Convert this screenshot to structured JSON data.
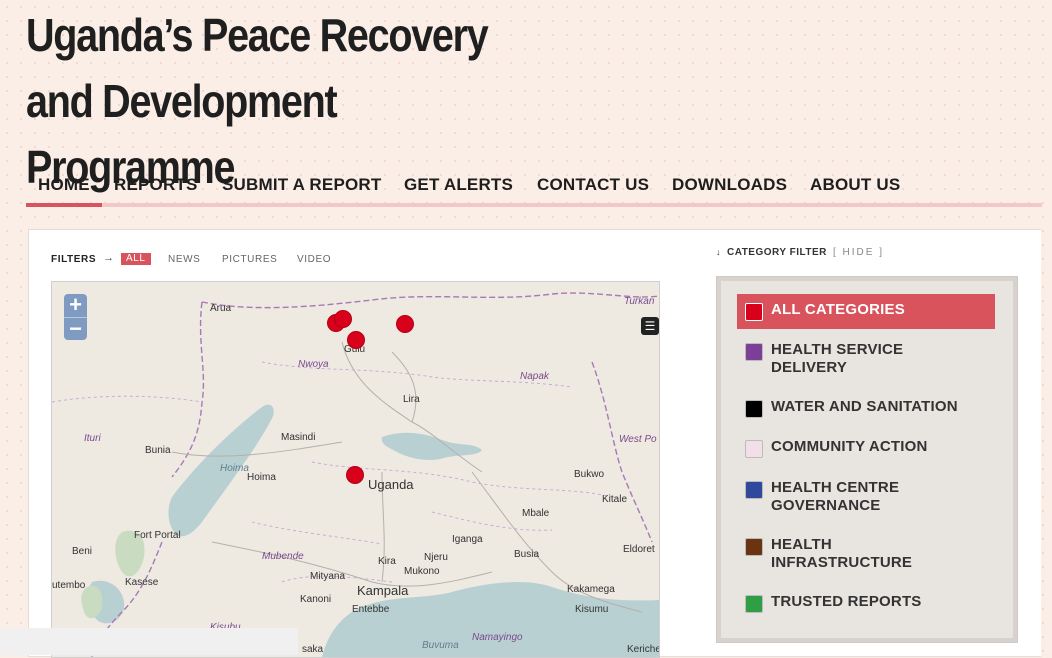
{
  "site": {
    "title": "Uganda’s Peace Recovery and Development Programme"
  },
  "nav": {
    "items": [
      {
        "label": "HOME",
        "active": true
      },
      {
        "label": "REPORTS"
      },
      {
        "label": "SUBMIT A REPORT"
      },
      {
        "label": "GET ALERTS"
      },
      {
        "label": "CONTACT US"
      },
      {
        "label": "DOWNLOADS"
      },
      {
        "label": "ABOUT US"
      }
    ]
  },
  "filters": {
    "label": "FILTERS",
    "arrow": "→",
    "options": [
      "ALL",
      "NEWS",
      "PICTURES",
      "VIDEO"
    ],
    "active": "ALL"
  },
  "map": {
    "zoom_in": "+",
    "zoom_out": "−",
    "layers_icon": "layers-icon",
    "places": {
      "arua": "Arua",
      "gulu": "Gulu",
      "nwoya": "Nwoya",
      "lira": "Lira",
      "napak": "Napak",
      "turkana": "Turkan",
      "ituri": "Ituri",
      "bunia": "Bunia",
      "masindi": "Masindi",
      "hoima_region": "Hoima",
      "hoima": "Hoima",
      "uganda": "Uganda",
      "west_pokot": "West Po",
      "bukwo": "Bukwo",
      "kitale": "Kitale",
      "mbale": "Mbale",
      "fort_portal": "Fort Portal",
      "beni": "Beni",
      "igang": "Iganga",
      "busia": "Busia",
      "eldoret": "Eldoret",
      "mubende": "Mubende",
      "kira": "Kira",
      "njeru": "Njeru",
      "mukono": "Mukono",
      "kasese": "Kasese",
      "mityana": "Mityana",
      "kakamega": "Kakamega",
      "kanoni": "Kanoni",
      "kampala": "Kampala",
      "kisumu": "Kisumu",
      "entebbe": "Entebbe",
      "lutembo": "utembo",
      "namayingo": "Namayingo",
      "kisubu": "Kisubu",
      "buvuma": "Buvuma",
      "masaka": "saka",
      "kericho": "Keriche"
    }
  },
  "category_filter": {
    "label": "CATEGORY FILTER",
    "hide_label": "[ HIDE ]",
    "categories": [
      {
        "label": "ALL CATEGORIES",
        "color": "#d9001b",
        "active": true
      },
      {
        "label": "HEALTH SERVICE DELIVERY",
        "color": "#7b3f98"
      },
      {
        "label": "WATER AND SANITATION",
        "color": "#000000"
      },
      {
        "label": "COMMUNITY ACTION",
        "color": "#f3dfe8"
      },
      {
        "label": "HEALTH CENTRE GOVERNANCE",
        "color": "#2f4a9c"
      },
      {
        "label": "HEALTH INFRASTRUCTURE",
        "color": "#6b3410"
      },
      {
        "label": "TRUSTED REPORTS",
        "color": "#2f9e44"
      }
    ]
  }
}
